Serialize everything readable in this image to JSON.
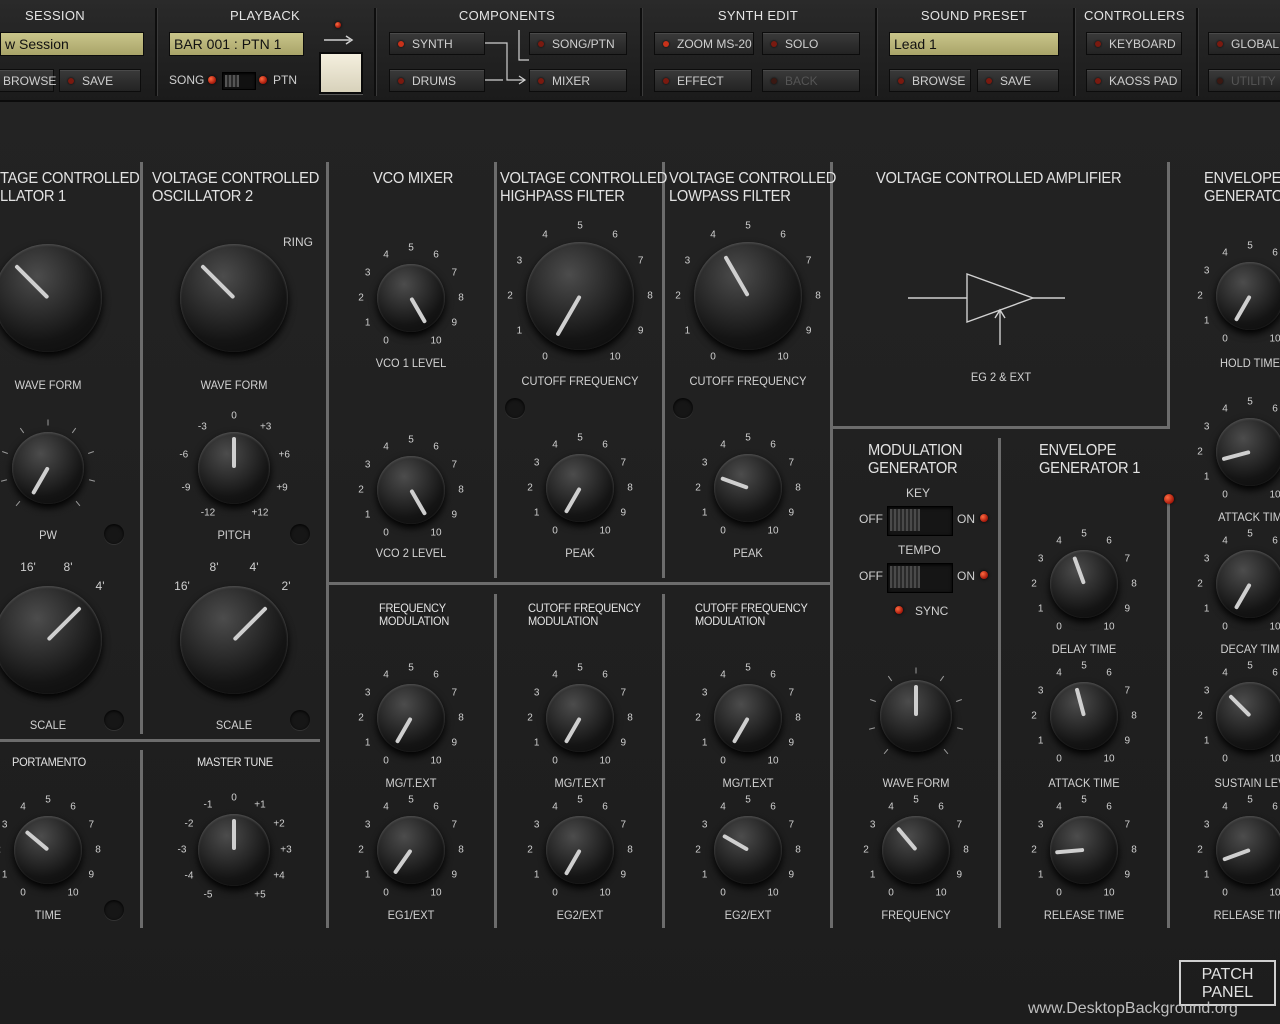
{
  "toolbar": {
    "session": {
      "title": "SESSION",
      "name": "w Session",
      "browse": "BROWSE",
      "save": "SAVE"
    },
    "playback": {
      "title": "PLAYBACK",
      "position": "BAR 001 : PTN 1",
      "song": "SONG",
      "ptn": "PTN"
    },
    "components": {
      "title": "COMPONENTS",
      "synth": "SYNTH",
      "drums": "DRUMS",
      "song_ptn": "SONG/PTN",
      "mixer": "MIXER"
    },
    "synth_edit": {
      "title": "SYNTH EDIT",
      "zoom": "ZOOM MS-20",
      "solo": "SOLO",
      "effect": "EFFECT",
      "back": "BACK"
    },
    "sound_preset": {
      "title": "SOUND PRESET",
      "name": "Lead 1",
      "browse": "BROWSE",
      "save": "SAVE"
    },
    "controllers": {
      "title": "CONTROLLERS",
      "keyboard": "KEYBOARD",
      "kaoss": "KAOSS PAD",
      "global": "GLOBAL",
      "utility": "UTILITY"
    }
  },
  "panel": {
    "vco1": {
      "title1": "TAGE CONTROLLED",
      "title2": "LLATOR   1"
    },
    "vco2": {
      "title1": "VOLTAGE CONTROLLED",
      "title2": "OSCILLATOR   2"
    },
    "mixer": {
      "title": "VCO MIXER"
    },
    "hpf": {
      "title1": "VOLTAGE CONTROLLED",
      "title2": "HIGHPASS FILTER"
    },
    "lpf": {
      "title1": "VOLTAGE CONTROLLED",
      "title2": "LOWPASS FILTER"
    },
    "vca": {
      "title": "VOLTAGE CONTROLLED AMPLIFIER",
      "input_label": "EG 2 & EXT"
    },
    "eg2": {
      "title1": "ENVELOPE",
      "title2": "GENERATOR"
    },
    "modgen": {
      "title1": "MODULATION",
      "title2": "GENERATOR",
      "key": "KEY",
      "tempo": "TEMPO",
      "off": "OFF",
      "on": "ON",
      "sync": "SYNC"
    },
    "eg1": {
      "title1": "ENVELOPE",
      "title2": "GENERATOR  1"
    },
    "fm": {
      "title1": "FREQUENCY",
      "title2": "MODULATION"
    },
    "cfm1": {
      "title1": "CUTOFF FREQUENCY",
      "title2": "MODULATION"
    },
    "cfm2": {
      "title1": "CUTOFF FREQUENCY",
      "title2": "MODULATION"
    },
    "portamento": {
      "title": "PORTAMENTO"
    },
    "master_tune": {
      "title": "MASTER TUNE"
    }
  },
  "knobs": [
    {
      "id": "vco1-wave",
      "label": "WAVE FORM",
      "angle": -45
    },
    {
      "id": "vco1-pw",
      "label": "PW",
      "angle": -150
    },
    {
      "id": "vco1-scale",
      "label": "SCALE",
      "angle": 45
    },
    {
      "id": "portamento-time",
      "label": "TIME",
      "angle": -50
    },
    {
      "id": "vco2-wave",
      "label": "WAVE FORM",
      "angle": -45
    },
    {
      "id": "vco2-pitch",
      "label": "PITCH",
      "angle": 0
    },
    {
      "id": "vco2-scale",
      "label": "SCALE",
      "angle": 45
    },
    {
      "id": "master-tune",
      "label": "",
      "angle": 0
    },
    {
      "id": "vco1-level",
      "label": "VCO 1 LEVEL",
      "angle": 150
    },
    {
      "id": "vco2-level",
      "label": "VCO 2 LEVEL",
      "angle": 150
    },
    {
      "id": "hpf-cutoff",
      "label": "CUTOFF FREQUENCY",
      "angle": -150
    },
    {
      "id": "hpf-peak",
      "label": "PEAK",
      "angle": -150
    },
    {
      "id": "lpf-cutoff",
      "label": "CUTOFF FREQUENCY",
      "angle": -30
    },
    {
      "id": "lpf-peak",
      "label": "PEAK",
      "angle": -70
    },
    {
      "id": "fm-mg",
      "label": "MG/T.EXT",
      "angle": -150
    },
    {
      "id": "fm-eg1",
      "label": "EG1/EXT",
      "angle": -145
    },
    {
      "id": "cfm1-mg",
      "label": "MG/T.EXT",
      "angle": -150
    },
    {
      "id": "cfm1-eg2",
      "label": "EG2/EXT",
      "angle": -150
    },
    {
      "id": "cfm2-mg",
      "label": "MG/T.EXT",
      "angle": -150
    },
    {
      "id": "cfm2-eg2",
      "label": "EG2/EXT",
      "angle": -60
    },
    {
      "id": "mg-wave",
      "label": "WAVE FORM",
      "angle": 0
    },
    {
      "id": "mg-frequency",
      "label": "FREQUENCY",
      "angle": -40
    },
    {
      "id": "eg1-delay",
      "label": "DELAY TIME",
      "angle": -20
    },
    {
      "id": "eg1-attack",
      "label": "ATTACK TIME",
      "angle": -15
    },
    {
      "id": "eg1-release",
      "label": "RELEASE TIME",
      "angle": -95
    },
    {
      "id": "eg2-hold",
      "label": "HOLD TIME",
      "angle": -150
    },
    {
      "id": "eg2-attack",
      "label": "ATTACK TIM",
      "angle": -105
    },
    {
      "id": "eg2-decay",
      "label": "DECAY TIM",
      "angle": -150
    },
    {
      "id": "eg2-sustain",
      "label": "SUSTAIN LEV",
      "angle": -45
    },
    {
      "id": "eg2-release",
      "label": "RELEASE TIM",
      "angle": -110
    }
  ],
  "scale_labels": {
    "zero_ten": [
      "0",
      "1",
      "2",
      "3",
      "4",
      "5",
      "6",
      "7",
      "8",
      "9",
      "10"
    ],
    "pitch": [
      "-12",
      "-9",
      "-6",
      "-3",
      "0",
      "+3",
      "+6",
      "+9",
      "+12"
    ],
    "tune": [
      "-5",
      "-4",
      "-3",
      "-2",
      "-1",
      "0",
      "+1",
      "+2",
      "+3",
      "+4",
      "+5"
    ],
    "scale_feet": [
      "16'",
      "8'",
      "4'",
      "2'"
    ],
    "vco1_scale_feet": [
      "16'",
      "8'",
      "4'"
    ],
    "ring": "RING"
  },
  "buttons": {
    "patch_panel1": "PATCH",
    "patch_panel2": "PANEL"
  },
  "watermark": "www.DesktopBackground.org"
}
